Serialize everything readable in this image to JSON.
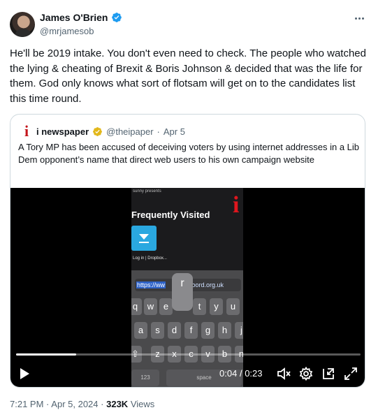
{
  "author": {
    "display_name": "James O'Brien",
    "handle": "@mrjamesob",
    "verified_color": "#1d9bf0"
  },
  "tweet": {
    "text": "He'll be 2019 intake. You don't even need to check. The people who watched the lying & cheating of Brexit & Boris Johnson & decided that was the life for them. God only knows what sort of flotsam will get on to the candidates list this time round."
  },
  "quote": {
    "logo_letter": "i",
    "name": "i newspaper",
    "handle": "@theipaper",
    "separator": "·",
    "date": "Apr 5",
    "text": "A Tory MP has been accused of deceiving voters by using internet addresses in a Lib Dem opponent’s name that direct web users to his own campaign website",
    "verified_color": "#e2b719"
  },
  "video": {
    "frame": {
      "small_text": "sunny presents",
      "title": "Frequently Visited",
      "logo_letter": "i",
      "tile_label": "Log in | Dropbox...",
      "url_selected": "https://ww",
      "url_rest": "dfoord.org.uk",
      "popup_key": "r",
      "row1": [
        "q",
        "w",
        "e",
        "r",
        "t",
        "y",
        "u"
      ],
      "row2": [
        "a",
        "s",
        "d",
        "f",
        "g",
        "h",
        "j"
      ],
      "row3": [
        "⇧",
        "z",
        "x",
        "c",
        "v",
        "b",
        "n"
      ],
      "bottom_left": "123",
      "bottom_space": "space"
    },
    "progress": 0.174,
    "time_current": "0:04",
    "time_separator": "/",
    "time_total": "0:23"
  },
  "footer": {
    "time": "7:21 PM",
    "dot1": "·",
    "date": "Apr 5, 2024",
    "dot2": "·",
    "views_count": "323K",
    "views_label": "Views"
  }
}
